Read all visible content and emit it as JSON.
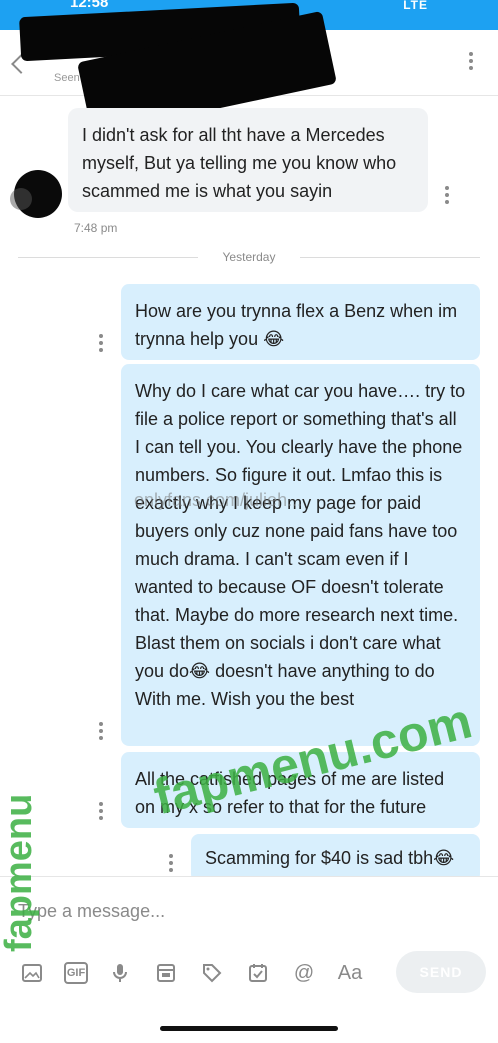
{
  "status_bar": {
    "time": "12:58",
    "signal": "LTE"
  },
  "header": {
    "seen_label": "Seen",
    "icons": [
      "message-icon",
      "star-icon",
      "pin-icon",
      "image-icon",
      "search-icon"
    ],
    "menu_icon": "more-vert-icon"
  },
  "messages": {
    "m1": {
      "direction": "incoming",
      "text": "I didn't ask for all tht have a Mercedes myself, But ya telling me you know who scammed me is what you sayin",
      "time": "7:48 pm"
    },
    "day_separator": "Yesterday",
    "m2": {
      "direction": "outgoing",
      "text": "How are you trynna flex a Benz when im trynna help you 😂"
    },
    "m3": {
      "direction": "outgoing",
      "text": "Why do I care what car you have…. try to file a police report or something that's all I can tell you. You clearly have the phone numbers. So figure it out. Lmfao this is exactly why I keep my page for paid buyers only cuz none paid fans have too much drama. I can't scam even if I wanted to because OF doesn't tolerate that. Maybe do more research next time. Blast them on socials i don't care what you do😂 doesn't have anything to do With me. Wish you the best"
    },
    "m4": {
      "direction": "outgoing",
      "text": "All the catfished pages of me are listed on my x so refer to that for the future"
    },
    "m5": {
      "direction": "outgoing",
      "text": "Scamming for $40 is sad tbh😂"
    }
  },
  "watermarks": {
    "horizontal": "fapmenu.com",
    "vertical": "fapmenu",
    "faint": "onlyfans.com/julieh..."
  },
  "composer": {
    "placeholder": "Type a message...",
    "tools": [
      "image-icon",
      "gif-icon",
      "microphone-icon",
      "vault-icon",
      "price-tag-icon",
      "poll-icon",
      "mention-icon",
      "text-format-icon"
    ],
    "gif_label": "GIF",
    "mention_label": "@",
    "text_label": "Aa",
    "send_label": "SEND"
  },
  "colors": {
    "accent": "#1da1f2",
    "outgoing_bubble": "#d8effd",
    "incoming_bubble": "#f1f3f5",
    "watermark": "#3cb043"
  }
}
